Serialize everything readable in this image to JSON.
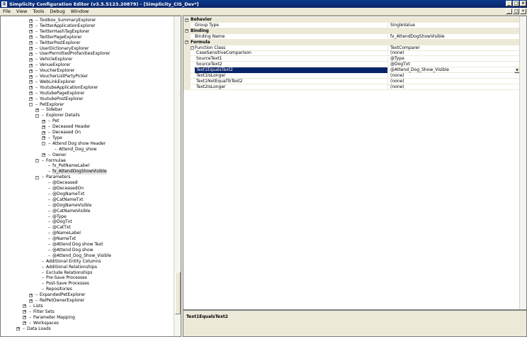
{
  "window": {
    "title": "Simplicity Configuration Editor (v3.5.5123.20879) - [Simplicity_CIS_Dev*]",
    "icon_name": "app-icon",
    "controls": [
      "_",
      "□",
      "×"
    ]
  },
  "menu": {
    "items": [
      "File",
      "View",
      "Tools",
      "Debug",
      "Window"
    ],
    "mdi_controls": [
      "_",
      "□",
      "×"
    ]
  },
  "tree": {
    "nodes": [
      {
        "label": "Toolbox_SummaryExplorer",
        "level": 3,
        "exp": "+"
      },
      {
        "label": "TwitterApplicationExplorer",
        "level": 3,
        "exp": "+"
      },
      {
        "label": "TwitterHashTagExplorer",
        "level": 3,
        "exp": "+"
      },
      {
        "label": "TwitterPageExplorer",
        "level": 3,
        "exp": "+"
      },
      {
        "label": "TwitterPostExplorer",
        "level": 3,
        "exp": "+"
      },
      {
        "label": "UserDictionaryExplorer",
        "level": 3,
        "exp": "+"
      },
      {
        "label": "UserPermittedProfanitiesExplorer",
        "level": 3,
        "exp": "+"
      },
      {
        "label": "VehicleExplorer",
        "level": 3,
        "exp": "+"
      },
      {
        "label": "VenueExplorer",
        "level": 3,
        "exp": "+"
      },
      {
        "label": "VoucherExplorer",
        "level": 3,
        "exp": "+"
      },
      {
        "label": "VoucherListPartyPicker",
        "level": 3,
        "exp": "+"
      },
      {
        "label": "WebLinkExplorer",
        "level": 3,
        "exp": "+"
      },
      {
        "label": "YoutubeApplicationExplorer",
        "level": 3,
        "exp": "+"
      },
      {
        "label": "YoutubePageExplorer",
        "level": 3,
        "exp": "+"
      },
      {
        "label": "YoutubePostExplorer",
        "level": 3,
        "exp": "+"
      },
      {
        "label": "PetExplorer",
        "level": 3,
        "exp": "-"
      },
      {
        "label": "Sidebar",
        "level": 4,
        "exp": "+"
      },
      {
        "label": "Explorer Details",
        "level": 4,
        "exp": "-"
      },
      {
        "label": "Pet",
        "level": 5,
        "exp": "+"
      },
      {
        "label": "Deceased Header",
        "level": 5,
        "exp": "+"
      },
      {
        "label": "Deceased On",
        "level": 5,
        "exp": "+"
      },
      {
        "label": "Type",
        "level": 5,
        "exp": "+"
      },
      {
        "label": "Attend Dog show Header",
        "level": 5,
        "exp": "-"
      },
      {
        "label": "Attend_Dog_show",
        "level": 6,
        "exp": ""
      },
      {
        "label": "Owner",
        "level": 5,
        "exp": "+"
      },
      {
        "label": "Formulae",
        "level": 4,
        "exp": "-"
      },
      {
        "label": "fx_PetNameLabel",
        "level": 5,
        "exp": ""
      },
      {
        "label": "fx_AttendDogShowVisible",
        "level": 5,
        "exp": "",
        "selected": true
      },
      {
        "label": "Parameters",
        "level": 4,
        "exp": "-"
      },
      {
        "label": "@Deceased",
        "level": 5,
        "exp": ""
      },
      {
        "label": "@DeceasedOn",
        "level": 5,
        "exp": ""
      },
      {
        "label": "@DogNameTxt",
        "level": 5,
        "exp": ""
      },
      {
        "label": "@CatNameTxt",
        "level": 5,
        "exp": ""
      },
      {
        "label": "@DogNameVisible",
        "level": 5,
        "exp": ""
      },
      {
        "label": "@CatNameVisible",
        "level": 5,
        "exp": ""
      },
      {
        "label": "@Type",
        "level": 5,
        "exp": ""
      },
      {
        "label": "@DogTxt",
        "level": 5,
        "exp": ""
      },
      {
        "label": "@CatTxt",
        "level": 5,
        "exp": ""
      },
      {
        "label": "@NameLabel",
        "level": 5,
        "exp": ""
      },
      {
        "label": "@NameTxt",
        "level": 5,
        "exp": ""
      },
      {
        "label": "@Attend Dog show Text",
        "level": 5,
        "exp": ""
      },
      {
        "label": "@Attend Dog show",
        "level": 5,
        "exp": ""
      },
      {
        "label": "@Attend_Dog_Show_Visible",
        "level": 5,
        "exp": ""
      },
      {
        "label": "Additional Entity Columns",
        "level": 4,
        "exp": ""
      },
      {
        "label": "Additional Relationships",
        "level": 4,
        "exp": ""
      },
      {
        "label": "Exclude Relationships",
        "level": 4,
        "exp": ""
      },
      {
        "label": "Pre-Save Processes",
        "level": 4,
        "exp": ""
      },
      {
        "label": "Post-Save Processes",
        "level": 4,
        "exp": ""
      },
      {
        "label": "Repositories",
        "level": 4,
        "exp": ""
      },
      {
        "label": "ExpandedPetExplorer",
        "level": 3,
        "exp": "+"
      },
      {
        "label": "RelPetOwnerExplorer",
        "level": 3,
        "exp": "+"
      },
      {
        "label": "Lists",
        "level": 2,
        "exp": "+"
      },
      {
        "label": "Filter Sets",
        "level": 2,
        "exp": "+"
      },
      {
        "label": "Parameter Mapping",
        "level": 2,
        "exp": "+"
      },
      {
        "label": "Workspaces",
        "level": 2,
        "exp": "+"
      },
      {
        "label": "Data Loads",
        "level": 1,
        "exp": "+"
      }
    ]
  },
  "properties": {
    "rows": [
      {
        "kind": "category",
        "label": "Behavior"
      },
      {
        "kind": "prop",
        "name": "Group Type",
        "value": "SingleValue",
        "indent": 0
      },
      {
        "kind": "category",
        "label": "Binding"
      },
      {
        "kind": "prop",
        "name": "Binding Name",
        "value": "fx_AttendDogShowVisible",
        "indent": 0
      },
      {
        "kind": "category",
        "label": "Formula"
      },
      {
        "kind": "prop",
        "name": "Function Class",
        "value": "TextComparer",
        "indent": 0,
        "exp": "-"
      },
      {
        "kind": "prop",
        "name": "CaseSensitiveComparison",
        "value": "(none)",
        "indent": 1
      },
      {
        "kind": "prop",
        "name": "SourceText1",
        "value": "@Type",
        "indent": 1
      },
      {
        "kind": "prop",
        "name": "SourceText2",
        "value": "@DogTxt",
        "indent": 1
      },
      {
        "kind": "prop",
        "name": "Text1EqualsText2",
        "value": "@Attend_Dog_Show_Visible",
        "indent": 1,
        "selected": true
      },
      {
        "kind": "prop",
        "name": "Text1IsLonger",
        "value": "(none)",
        "indent": 1
      },
      {
        "kind": "prop",
        "name": "Text1NotEqualToText2",
        "value": "(none)",
        "indent": 1
      },
      {
        "kind": "prop",
        "name": "Text2IsLonger",
        "value": "(none)",
        "indent": 1
      }
    ],
    "dropdown_glyph": "▼"
  },
  "help": {
    "title": "Text1EqualsText2"
  }
}
